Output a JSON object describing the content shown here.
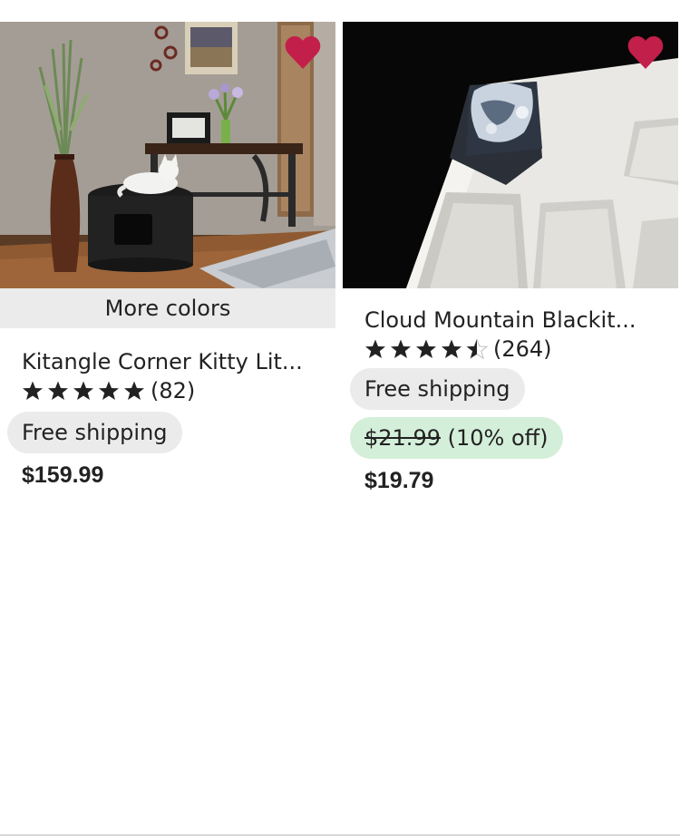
{
  "colors": {
    "favorite": "#c21f4a",
    "pill_gray": "#ebebeb",
    "pill_green": "#d4efd9",
    "text": "#222222"
  },
  "listings": [
    {
      "image_alt": "Black round litter box with white cat beside a console table",
      "badge": "More colors",
      "title": "Kitangle Corner Kitty Lit...",
      "rating": 5.0,
      "rating_count": "(82)",
      "shipping": "Free shipping",
      "price": "$159.99",
      "favorited": true
    },
    {
      "image_alt": "Artisan keycap with cloud mountain resin on white keyboard",
      "title": "Cloud Mountain Blackit...",
      "rating": 4.5,
      "rating_count": "(264)",
      "shipping": "Free shipping",
      "original_price": "$21.99",
      "discount": "(10% off)",
      "price": "$19.79",
      "favorited": true
    }
  ]
}
